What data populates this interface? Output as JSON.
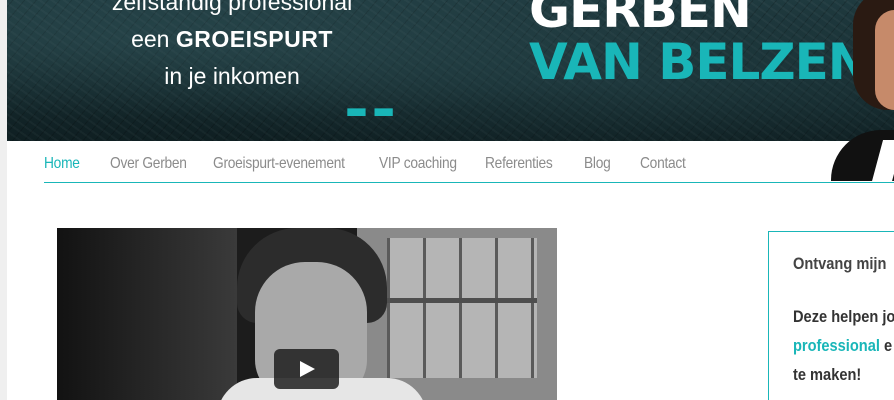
{
  "header": {
    "tagline": {
      "line1": "zelfstandig professional",
      "line2_prefix": "een ",
      "line2_strong": "GROEISPURT",
      "line3": "in je inkomen"
    },
    "quote_glyph": "„",
    "brand_first": "GERBEN",
    "brand_last": "VAN BELZEN"
  },
  "nav": {
    "items": [
      {
        "label": "Home",
        "active": true
      },
      {
        "label": "Over Gerben"
      },
      {
        "label": "Groeispurt-evenement"
      },
      {
        "label": "VIP coaching"
      },
      {
        "label": "Referenties"
      },
      {
        "label": "Blog"
      },
      {
        "label": "Contact"
      }
    ]
  },
  "video": {
    "icon": "play-icon"
  },
  "sidebar": {
    "optin_title": "Ontvang mijn",
    "optin_line1": "Deze helpen jo",
    "optin_line2_accent": "professional",
    "optin_line2_rest": " e",
    "optin_line3": "te maken!"
  },
  "colors": {
    "accent": "#19b6b8",
    "nav_text": "#8b8b8b",
    "header_bg": "#16292d"
  }
}
